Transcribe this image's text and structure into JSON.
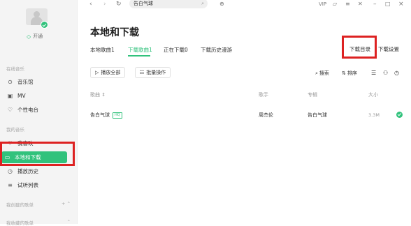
{
  "user": {
    "open_vip": "开通"
  },
  "sidebar": {
    "online_section": "在线音乐",
    "online_items": [
      {
        "label": "音乐馆",
        "icon": "music-hall-icon"
      },
      {
        "label": "MV",
        "icon": "mv-icon"
      },
      {
        "label": "个性电台",
        "icon": "radio-icon"
      }
    ],
    "my_section": "我的音乐",
    "my_items": [
      {
        "label": "我喜欢",
        "icon": "heart-icon"
      },
      {
        "label": "本地和下载",
        "icon": "monitor-icon"
      },
      {
        "label": "播放历史",
        "icon": "history-icon"
      },
      {
        "label": "试听列表",
        "icon": "list-icon"
      }
    ],
    "created_playlists": "我创建的歌单",
    "collected_playlists": "我收藏的歌单"
  },
  "topbar": {
    "search_value": "告白气球",
    "vip": "VIP"
  },
  "page": {
    "title": "本地和下载"
  },
  "tabs": [
    "本地歌曲1",
    "下载歌曲1",
    "正在下载0",
    "下载历史漫游"
  ],
  "actions": {
    "download_dir": "下载目录",
    "download_settings": "下载设置"
  },
  "toolbar": {
    "play_all": "播放全部",
    "batch": "批量操作",
    "search": "搜索",
    "sort": "排序"
  },
  "table": {
    "headers": [
      "歌曲",
      "歌手",
      "专辑",
      "大小"
    ],
    "rows": [
      {
        "song": "告白气球",
        "quality": "HQ",
        "singer": "周杰伦",
        "album": "告白气球",
        "size": "3.3M"
      }
    ]
  },
  "colors": {
    "accent": "#31c27c",
    "highlight": "#dd2222"
  }
}
